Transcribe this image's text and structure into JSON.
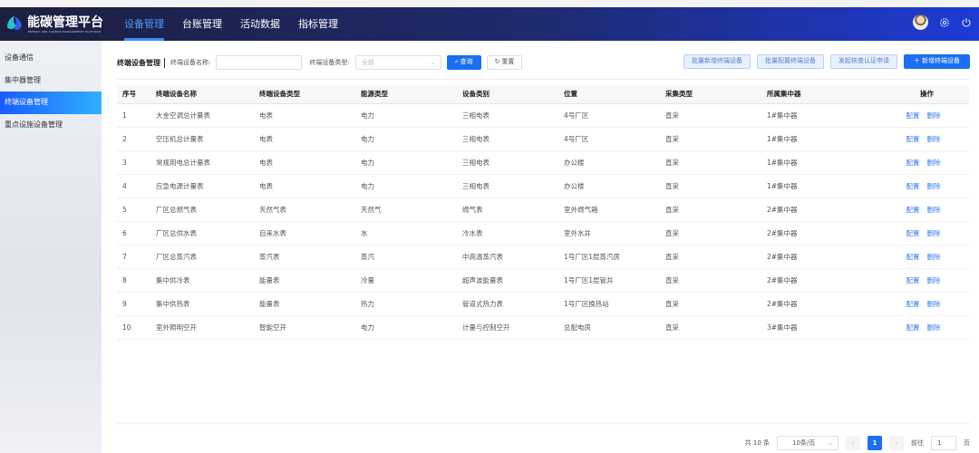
{
  "header": {
    "brand": "能碳管理平台",
    "brand_sub": "ENERGY AND CARBON MANAGEMENT PLATFORM",
    "nav": [
      "设备管理",
      "台账管理",
      "活动数据",
      "指标管理"
    ],
    "active_nav": 0
  },
  "sidebar": {
    "items": [
      "设备通信",
      "集中器管理",
      "终端设备管理",
      "重点设施设备管理"
    ],
    "active": 2
  },
  "toolbar": {
    "title": "终端设备管理",
    "name_label": "终端设备名称:",
    "name_value": "",
    "type_label": "终端设备类型:",
    "type_value": "全部",
    "query": "查询",
    "reset": "重置",
    "batch_add": "批量新增终端设备",
    "batch_config": "批量配置终端设备",
    "verify": "发起核查认证申请",
    "add": "新增终端设备"
  },
  "table": {
    "columns": [
      "序号",
      "终端设备名称",
      "终端设备类型",
      "能源类型",
      "设备类别",
      "位置",
      "采集类型",
      "所属集中器",
      "操作"
    ],
    "rows": [
      [
        "1",
        "大金空调总计量表",
        "电表",
        "电力",
        "三相电表",
        "4号厂区",
        "直采",
        "1#集中器"
      ],
      [
        "2",
        "空压机总计量表",
        "电表",
        "电力",
        "三相电表",
        "4号厂区",
        "直采",
        "1#集中器"
      ],
      [
        "3",
        "常规用电总计量表",
        "电表",
        "电力",
        "三相电表",
        "办公楼",
        "直采",
        "1#集中器"
      ],
      [
        "4",
        "应急电源计量表",
        "电表",
        "电力",
        "三相电表",
        "办公楼",
        "直采",
        "1#集中器"
      ],
      [
        "5",
        "厂区总燃气表",
        "天然气表",
        "天然气",
        "燃气表",
        "室外燃气箱",
        "直采",
        "2#集中器"
      ],
      [
        "6",
        "厂区总供水表",
        "自来水表",
        "水",
        "冷水表",
        "室外水井",
        "直采",
        "2#集中器"
      ],
      [
        "7",
        "厂区总蒸汽表",
        "蒸汽表",
        "蒸汽",
        "中高温蒸汽表",
        "1号厂区1层蒸汽房",
        "直采",
        "2#集中器"
      ],
      [
        "8",
        "集中供冷表",
        "能量表",
        "冷量",
        "超声波能量表",
        "1号厂区1层管井",
        "直采",
        "2#集中器"
      ],
      [
        "9",
        "集中供热表",
        "能量表",
        "热力",
        "管道式热力表",
        "1号厂区换热站",
        "直采",
        "2#集中器"
      ],
      [
        "10",
        "室外照明空开",
        "智能空开",
        "电力",
        "计量与控制空开",
        "总配电房",
        "直采",
        "3#集中器"
      ]
    ],
    "actions": [
      "配置",
      "删除"
    ]
  },
  "pagination": {
    "total": "共 10 条",
    "page_size": "10条/页",
    "current": "1",
    "goto_label": "前往",
    "goto_value": "1",
    "page_suffix": "页"
  },
  "colors": {
    "accent": "#1a6ff5",
    "header_dark": "#1c1f3f",
    "header_blue": "#1e3bd6"
  }
}
